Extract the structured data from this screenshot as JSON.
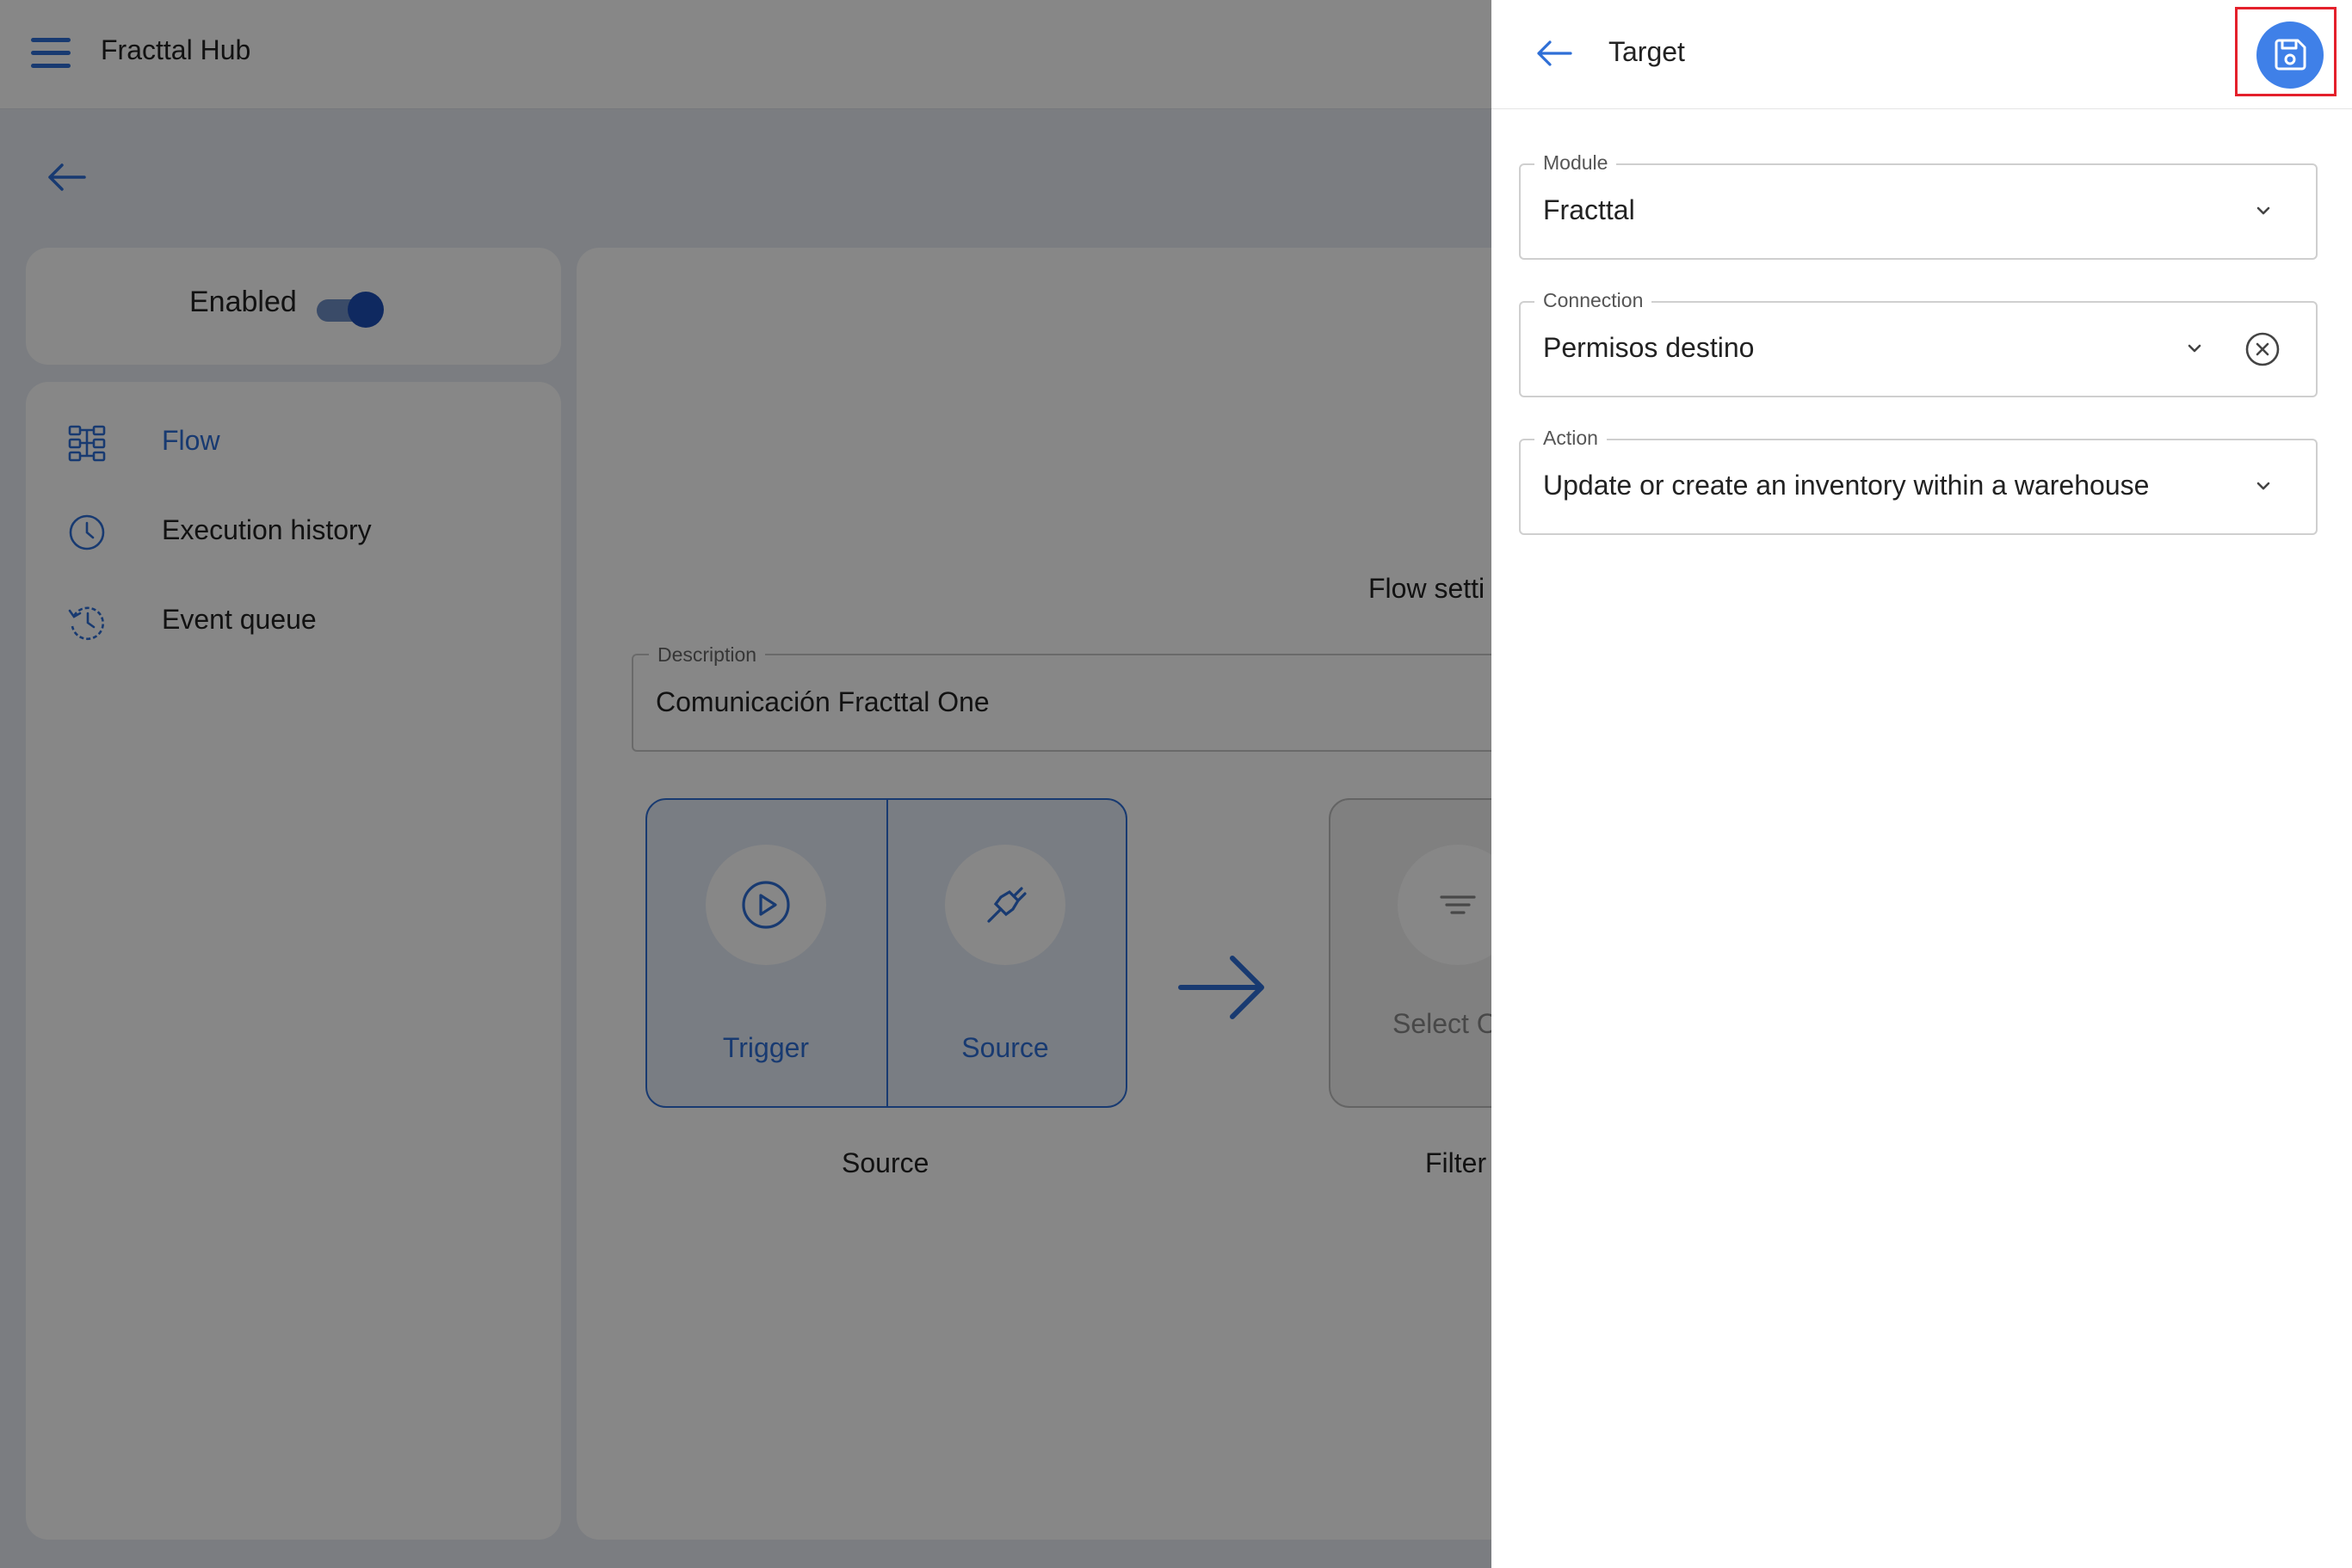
{
  "header": {
    "app_title": "Fracttal Hub"
  },
  "status_card": {
    "enabled_label": "Enabled",
    "enabled": true
  },
  "sidebar": {
    "items": [
      {
        "label": "Flow",
        "icon": "flow-icon",
        "active": true
      },
      {
        "label": "Execution history",
        "icon": "clock-icon",
        "active": false
      },
      {
        "label": "Event queue",
        "icon": "history-icon",
        "active": false
      }
    ]
  },
  "main": {
    "flow_settings_label": "Flow setti",
    "description": {
      "label": "Description",
      "value": "Comunicación Fracttal One"
    },
    "source_group": {
      "trigger_label": "Trigger",
      "source_label": "Source",
      "caption": "Source"
    },
    "filter_group": {
      "select_label": "Select O",
      "caption": "Filter"
    }
  },
  "panel": {
    "title": "Target",
    "module": {
      "label": "Module",
      "value": "Fracttal"
    },
    "connection": {
      "label": "Connection",
      "value": "Permisos destino"
    },
    "action": {
      "label": "Action",
      "value": "Update or create an inventory within a warehouse"
    }
  },
  "colors": {
    "accent": "#2f6fd6",
    "save_button": "#3f80e8",
    "highlight_border": "#e4202b",
    "toggle_on": "#1e4fb5"
  }
}
